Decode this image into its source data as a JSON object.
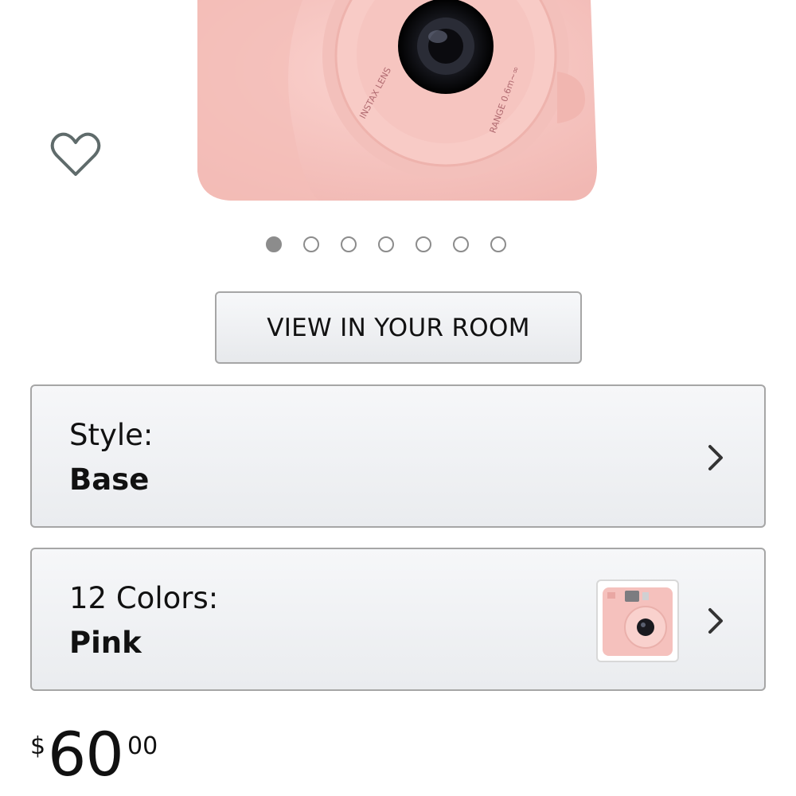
{
  "product": {
    "image_icon": "camera-product-image",
    "image_alt": "Pink instant camera",
    "lens_ring_text": "INSTAX LENS",
    "range_text": "RANGE 0.6m~∞"
  },
  "favorite": {
    "icon": "heart-icon"
  },
  "carousel": {
    "count": 7,
    "active_index": 0
  },
  "view_room": {
    "label": "VIEW IN YOUR ROOM"
  },
  "style_option": {
    "label": "Style:",
    "value": "Base",
    "icon": "chevron-right-icon"
  },
  "color_option": {
    "label": "12 Colors:",
    "value": "Pink",
    "swatch_icon": "pink-camera-thumbnail",
    "icon": "chevron-right-icon"
  },
  "price": {
    "currency": "$",
    "whole": "60",
    "fraction": "00"
  },
  "colors": {
    "camera_pink": "#f6c4c0",
    "border_gray": "#a6a6a6",
    "dot_gray": "#8c8c8c",
    "heart": "#5f6b6b"
  }
}
